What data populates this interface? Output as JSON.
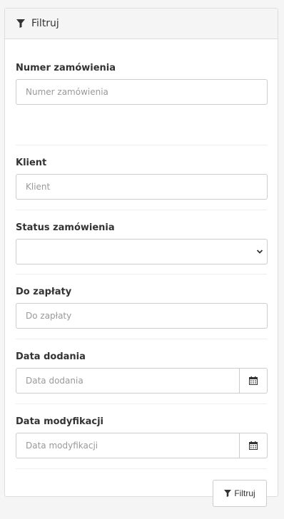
{
  "panel": {
    "title": "Filtruj",
    "title_icon": "filter-icon"
  },
  "fields": {
    "order_number": {
      "label": "Numer zamówienia",
      "placeholder": "Numer zamówienia",
      "value": ""
    },
    "client": {
      "label": "Klient",
      "placeholder": "Klient",
      "value": ""
    },
    "order_status": {
      "label": "Status zamówienia",
      "selected": ""
    },
    "to_pay": {
      "label": "Do zapłaty",
      "placeholder": "Do zapłaty",
      "value": ""
    },
    "date_added": {
      "label": "Data dodania",
      "placeholder": "Data dodania",
      "value": "",
      "icon": "calendar-icon"
    },
    "date_modified": {
      "label": "Data modyfikacji",
      "placeholder": "Data modyfikacji",
      "value": "",
      "icon": "calendar-icon"
    }
  },
  "footer": {
    "filter_button_label": "Filtruj",
    "filter_button_icon": "filter-icon"
  }
}
